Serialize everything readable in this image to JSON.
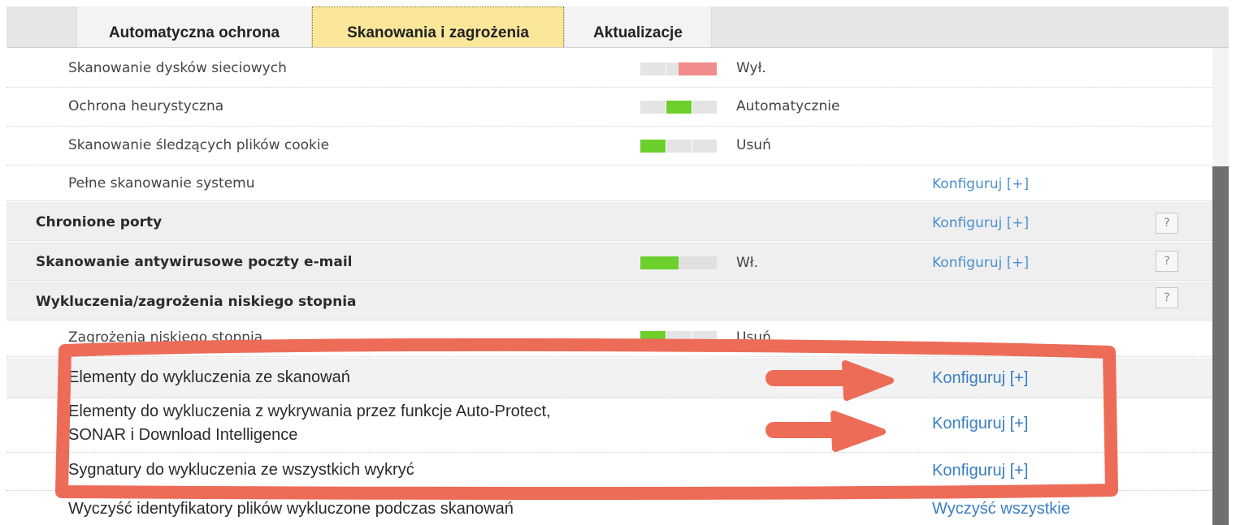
{
  "tabs": [
    {
      "label": "Automatyczna ochrona"
    },
    {
      "label": "Skanowania i zagrożenia"
    },
    {
      "label": "Aktualizacje"
    }
  ],
  "rows": {
    "network_drives": {
      "label": "Skanowanie dysków sieciowych",
      "status": "Wył."
    },
    "heuristic": {
      "label": "Ochrona heurystyczna",
      "status": "Automatycznie"
    },
    "cookies": {
      "label": "Skanowanie śledzących plików cookie",
      "status": "Usuń"
    },
    "full_scan": {
      "label": "Pełne skanowanie systemu",
      "link": "Konfiguruj [+]"
    },
    "ports": {
      "label": "Chronione porty",
      "link": "Konfiguruj [+]",
      "help": "?"
    },
    "email": {
      "label": "Skanowanie antywirusowe poczty e-mail",
      "status": "Wł.",
      "link": "Konfiguruj [+]",
      "help": "?"
    },
    "exclusions": {
      "label": "Wykluczenia/zagrożenia niskiego stopnia",
      "help": "?"
    },
    "low_risk": {
      "label": "Zagrożenia niskiego stopnia",
      "status": "Usuń"
    },
    "scan_exclusions": {
      "label": "Elementy do wykluczenia ze skanowań",
      "link": "Konfiguruj [+]"
    },
    "autoprotect_exclusions": {
      "label_line1": "Elementy do wykluczenia z wykrywania przez funkcje Auto-Protect,",
      "label_line2": "SONAR i Download Intelligence",
      "link": "Konfiguruj [+]"
    },
    "signature_exclusions": {
      "label": "Sygnatury do wykluczenia ze wszystkich wykryć",
      "link": "Konfiguruj [+]"
    },
    "clear_ids": {
      "label": "Wyczyść identyfikatory plików wykluczone podczas skanowań",
      "link": "Wyczyść wszystkie"
    }
  },
  "colors": {
    "toggle_on": "#6ccf2c",
    "toggle_off_red": "#f08c8c",
    "link": "#4a90d0",
    "annotation": "#ec6c58",
    "active_tab": "#fbe79a"
  }
}
